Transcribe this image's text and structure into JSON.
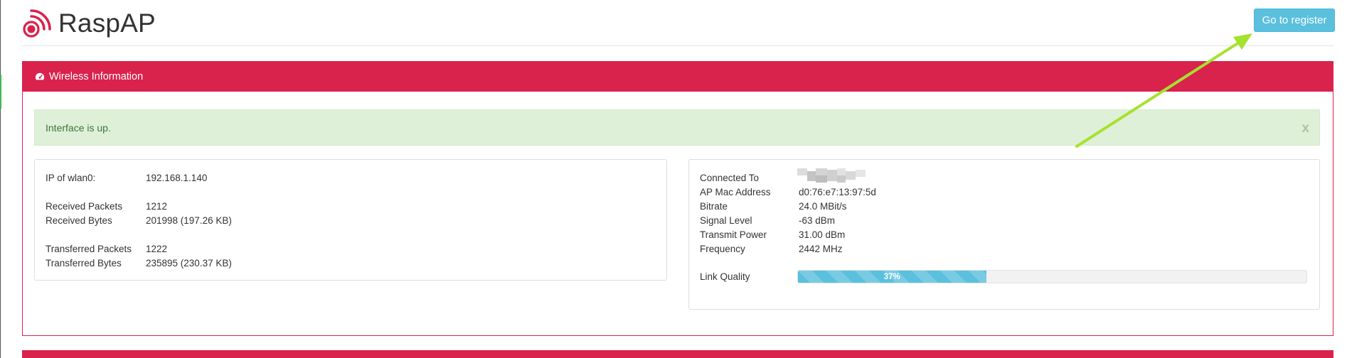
{
  "app": {
    "title": "RaspAP"
  },
  "header": {
    "register_label": "Go to register"
  },
  "panel": {
    "title": "Wireless Information"
  },
  "alert": {
    "message": "Interface is up.",
    "close_label": "x"
  },
  "interface_stats": {
    "ip_label": "IP of wlan0:",
    "ip_value": "192.168.1.140",
    "rx_packets_label": "Received Packets",
    "rx_packets_value": "1212",
    "rx_bytes_label": "Received Bytes",
    "rx_bytes_value": "201998 (197.26 KB)",
    "tx_packets_label": "Transferred Packets",
    "tx_packets_value": "1222",
    "tx_bytes_label": "Transferred Bytes",
    "tx_bytes_value": "235895 (230.37 KB)"
  },
  "connection": {
    "connected_label": "Connected To",
    "ap_mac_label": "AP Mac Address",
    "ap_mac_value": "d0:76:e7:13:97:5d",
    "bitrate_label": "Bitrate",
    "bitrate_value": "24.0 MBit/s",
    "signal_label": "Signal Level",
    "signal_value": "-63 dBm",
    "tx_power_label": "Transmit Power",
    "tx_power_value": "31.00 dBm",
    "frequency_label": "Frequency",
    "frequency_value": "2442 MHz",
    "link_quality_label": "Link Quality",
    "link_quality_text": "37%",
    "link_quality_percent": 37
  },
  "colors": {
    "brand": "#d9224c",
    "info": "#5bc0de",
    "success_bg": "#dff0d8",
    "annotation": "#a6e22e"
  },
  "icons": {
    "logo": "raspap-signal-logo",
    "panel": "dashboard-icon",
    "annotation": "arrow-annotation"
  }
}
